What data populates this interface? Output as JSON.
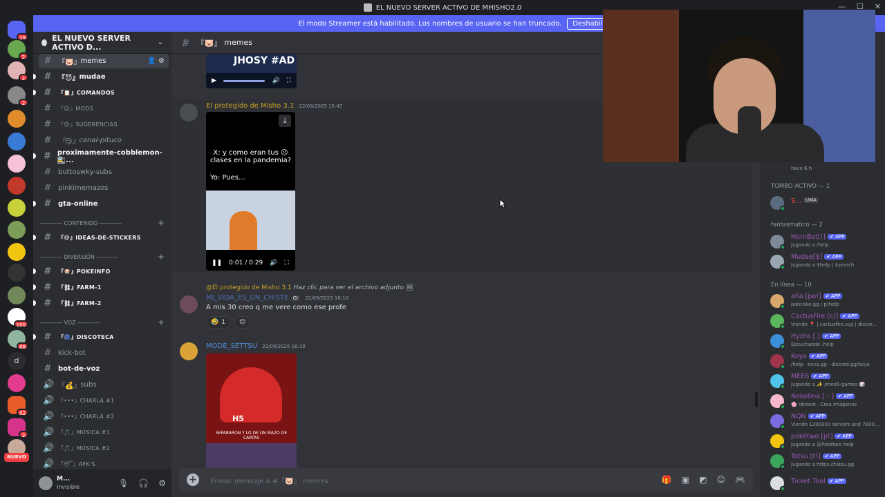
{
  "window": {
    "title": "EL NUEVO SERVER ACTIVO DE MHISHO2.0"
  },
  "banner": {
    "text": "El modo Streamer está habilitado. Los nombres de usuario se han truncado.",
    "button": "Deshabilitar"
  },
  "rail": {
    "badges": [
      "19",
      "2",
      "2",
      "2",
      "100",
      "68",
      "52",
      "3"
    ],
    "letter": "d",
    "new_label": "NUEVO"
  },
  "server": {
    "name": "EL NUEVO SERVER ACTIVO D..."
  },
  "channels": [
    {
      "name": "memes",
      "prefix": "『🐷』"
    },
    {
      "name": "mudae",
      "prefix": "『😈』"
    },
    {
      "name": "comandos",
      "prefix": "『📋』"
    },
    {
      "name": "mods",
      "prefix": "『😐』"
    },
    {
      "name": "sugerencias",
      "prefix": "『😕』"
    },
    {
      "name": "canal-pituco",
      "prefix": "『😏』"
    },
    {
      "name": "proximamente-cobblemon-🚉..."
    },
    {
      "name": "buttoswky-subs"
    },
    {
      "name": "pinkimemazos"
    },
    {
      "name": "gta-online"
    }
  ],
  "categories": {
    "contenido": "———— CONTENIDO ————",
    "diversion": "———— DIVERSIÓN ————",
    "voz": "———— VOZ ————"
  },
  "channels2": [
    {
      "name": "ideas-de-stickers",
      "prefix": "『😅』"
    },
    {
      "name": "pokeinfo",
      "prefix": "『🐶』"
    },
    {
      "name": "farm-1",
      "prefix": "『⛓』"
    },
    {
      "name": "farm-2",
      "prefix": "『⛓』"
    },
    {
      "name": "discoteca",
      "prefix": "『🎆』"
    },
    {
      "name": "kick-bot"
    },
    {
      "name": "bot-de-voz"
    },
    {
      "name": "subs",
      "prefix": "『💰』"
    },
    {
      "name": "charla #1",
      "prefix": "『•••』"
    },
    {
      "name": "charla #2",
      "prefix": "『•••』"
    },
    {
      "name": "música #1",
      "prefix": "『🎵』"
    },
    {
      "name": "música #2",
      "prefix": "『🎵』"
    },
    {
      "name": "afk's",
      "prefix": "『😴』"
    }
  ],
  "user": {
    "name": "M...",
    "status": "Invisible"
  },
  "chat": {
    "channel": "memes",
    "channel_prefix": "『🐷』",
    "video1_text": "JHOSY #AD",
    "msg1": {
      "author": "El protegido de Misho 3.1",
      "time": "22/09/2025 15:47",
      "video_caption1": "X: y como eran tus 😐 clases en la pandemia?",
      "video_caption2": "Yo: Pues...",
      "video_time": "0:01 / 0:29"
    },
    "msg2": {
      "reply_to": "@El protegido de Misho 3.1",
      "reply_text": "Haz clic para ver el archivo adjunto",
      "author": "MI_VIDA_ES_UN_CHISTE",
      "tag": "GI",
      "time": "22/09/2025 16:10",
      "text": "A mis 30 creo q me vere como ese profe",
      "reaction_emoji": "🤣",
      "reaction_count": "1"
    },
    "msg3": {
      "author": "MODE_SETTSU",
      "time": "22/09/2025 16:18",
      "video_caption": "SEPARARON Y LO DE UN MAZO DE CARTAS",
      "video_tag": "H5"
    },
    "composer_placeholder": "Enviar mensaje a #『🐷』 memes"
  },
  "members": {
    "top_item": {
      "name": "Beta 2",
      "status": "hace 6 h"
    },
    "group1": "TOMBO ACTIVO — 1",
    "group1_items": [
      {
        "name": "S...",
        "role": "UMA"
      }
    ],
    "group2": "fantasmatico — 2",
    "group2_items": [
      {
        "name": "HornBot[!]",
        "tag": "✔ APP",
        "status": "Jugando a /help",
        "color": "#9b59b6"
      },
      {
        "name": "Mudae[$]",
        "tag": "✔ APP",
        "status": "Jugando a $help | $search",
        "color": "#9b59b6"
      }
    ],
    "group3": "En línea — 10",
    "group3_items": [
      {
        "name": "aña [pa!]",
        "tag": "✔ APP",
        "status": "pancake.gg | p!help",
        "color": "#9b59b6"
      },
      {
        "name": "CactusFire [c/]",
        "tag": "✔ APP",
        "status": "Viendo 📍 | cactusfire.xyz | discor...",
        "color": "#9b59b6"
      },
      {
        "name": "Hydra [.]",
        "tag": "✔ APP",
        "status": "Escuchando .help",
        "color": "#9b59b6"
      },
      {
        "name": "Koya",
        "tag": "✔ APP",
        "status": "/help · koya.gg · discord.gg/koya",
        "color": "#9b59b6"
      },
      {
        "name": "MEE6",
        "tag": "✔ APP",
        "status": "Jugando a ✨ /mee6-games 🎲",
        "color": "#9b59b6"
      },
      {
        "name": "Nekotina [ - ]",
        "tag": "✔ APP",
        "status": "🌸 /dream · Crea imágenes",
        "color": "#9b59b6"
      },
      {
        "name": "NQN",
        "tag": "✔ APP",
        "status": "Viendo 1200000 servers and 7600...",
        "color": "#9b59b6"
      },
      {
        "name": "pokétwo [p!]",
        "tag": "✔ APP",
        "status": "Jugando a @Pokétwo help",
        "color": "#9b59b6"
      },
      {
        "name": "Tatsu [t!]",
        "tag": "✔ APP",
        "status": "Jugando a https://tatsu.gg",
        "color": "#9b59b6"
      },
      {
        "name": "Ticket Tool",
        "tag": "✔ APP",
        "status": "",
        "color": "#9b59b6"
      }
    ]
  }
}
